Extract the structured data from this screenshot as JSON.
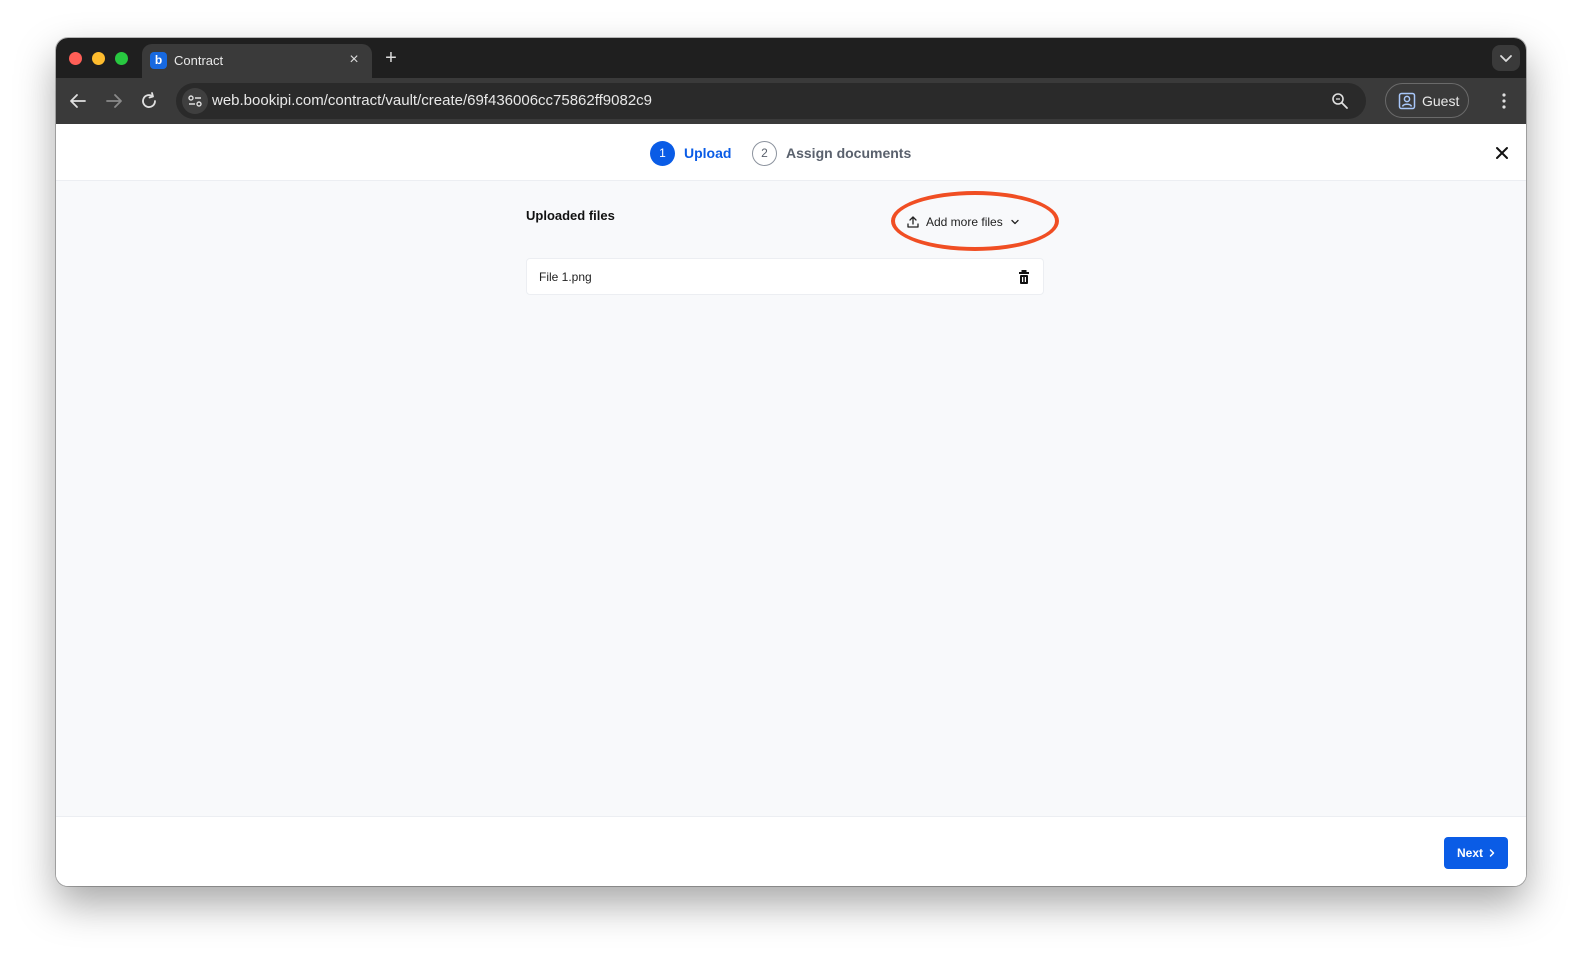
{
  "browser": {
    "tab_title": "Contract",
    "tab_close": "×",
    "new_tab": "+",
    "url": "web.bookipi.com/contract/vault/create/69f436006cc75862ff9082c9",
    "profile_label": "Guest",
    "favicon_glyph": "b"
  },
  "stepper": {
    "steps": [
      {
        "number": "1",
        "label": "Upload",
        "active": true
      },
      {
        "number": "2",
        "label": "Assign documents",
        "active": false
      }
    ]
  },
  "uploads": {
    "title": "Uploaded files",
    "add_more_label": "Add more files",
    "files": [
      {
        "name": "File 1.png"
      }
    ]
  },
  "footer": {
    "next_label": "Next"
  },
  "colors": {
    "accent": "#0a5ce6",
    "highlight": "#f04e23"
  },
  "icons": {
    "upload": "upload-icon",
    "chevron": "chevron-down-icon",
    "trash": "trash-icon",
    "close": "close-icon"
  }
}
